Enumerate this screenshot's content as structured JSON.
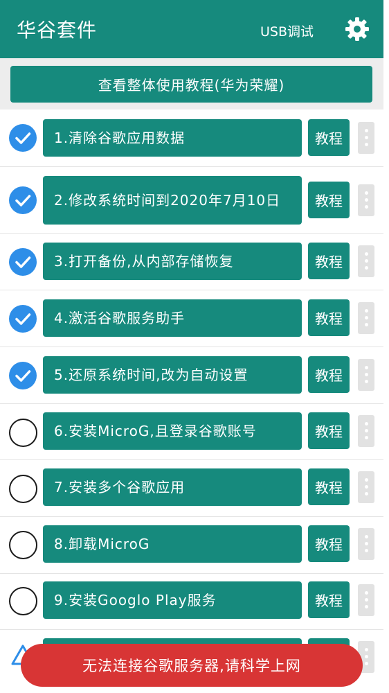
{
  "app_bar": {
    "title": "华谷套件",
    "usb_debug": "USB调试",
    "settings_icon": "gear-icon",
    "color": "#168a7d"
  },
  "tutorial_all": "查看整体使用教程(华为荣耀)",
  "steps": [
    {
      "label": "1.清除谷歌应用数据",
      "done": true,
      "tutorial": "教程"
    },
    {
      "label": "2.修改系统时间到2020年7月10日",
      "done": true,
      "tutorial": "教程"
    },
    {
      "label": "3.打开备份,从内部存储恢复",
      "done": true,
      "tutorial": "教程"
    },
    {
      "label": "4.激活谷歌服务助手",
      "done": true,
      "tutorial": "教程"
    },
    {
      "label": "5.还原系统时间,改为自动设置",
      "done": true,
      "tutorial": "教程"
    },
    {
      "label": "6.安装MicroG,且登录谷歌账号",
      "done": false,
      "tutorial": "教程"
    },
    {
      "label": "7.安装多个谷歌应用",
      "done": false,
      "tutorial": "教程"
    },
    {
      "label": "8.卸载MicroG",
      "done": false,
      "tutorial": "教程"
    },
    {
      "label": "9.安装Googlo Play服务",
      "done": false,
      "tutorial": "教程"
    }
  ],
  "toast": {
    "message": "无法连接谷歌服务器,请科学上网",
    "color": "#d83535"
  },
  "colors": {
    "check": "#2e8ee8",
    "warning": "#2e8ee8"
  }
}
